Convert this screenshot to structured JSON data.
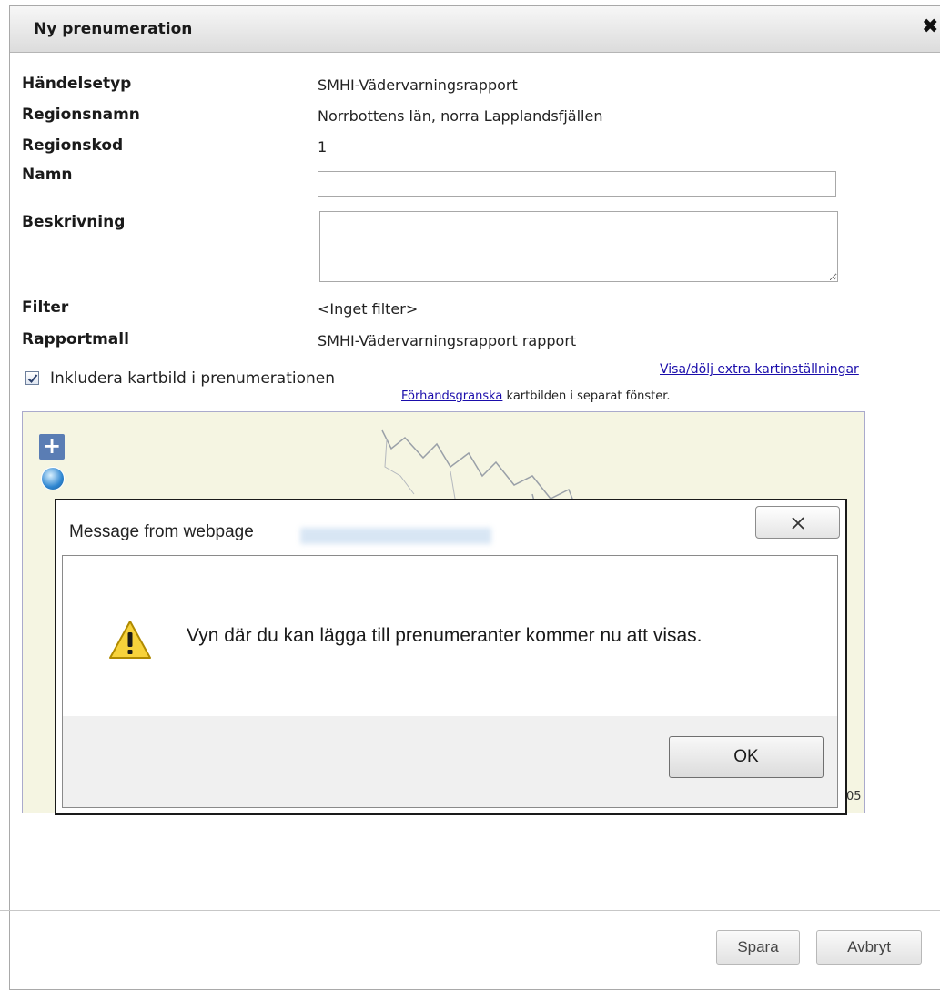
{
  "dialog": {
    "title": "Ny prenumeration",
    "close_symbol": "✖"
  },
  "fields": [
    {
      "label": "Händelsetyp",
      "value": "SMHI-Vädervarningsrapport"
    },
    {
      "label": "Regionsnamn",
      "value": "Norrbottens län, norra Lapplandsfjällen"
    },
    {
      "label": "Regionskod",
      "value": "1"
    },
    {
      "label": "Namn",
      "value": ""
    },
    {
      "label": "Beskrivning",
      "value": ""
    },
    {
      "label": "Filter",
      "value": "<Inget filter>"
    },
    {
      "label": "Rapportmall",
      "value": "SMHI-Vädervarningsrapport rapport"
    }
  ],
  "map_options": {
    "include_map_checked": true,
    "include_map_label": "Inkludera kartbild i prenumerationen",
    "toggle_link": "Visa/dölj extra kartinställningar",
    "preview_link": "Förhandsgranska",
    "preview_suffix": " kartbilden i separat fönster."
  },
  "map": {
    "zoom_in_label": "+",
    "attribution": "05",
    "colors": {
      "land": "#f5f5e2",
      "control": "#5a7db4"
    }
  },
  "footer": {
    "save_label": "Spara",
    "cancel_label": "Avbryt"
  },
  "message_box": {
    "title": "Message from webpage",
    "text": "Vyn där du kan lägga till prenumeranter kommer nu att visas.",
    "ok_label": "OK",
    "icon": "warning-icon"
  }
}
